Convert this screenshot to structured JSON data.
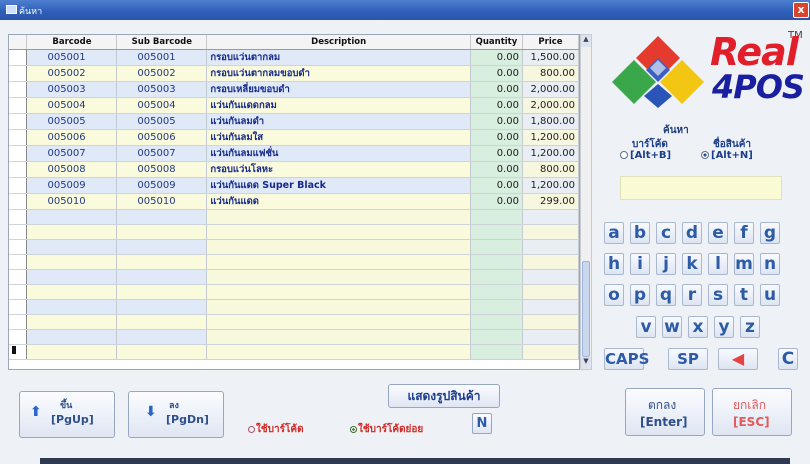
{
  "window": {
    "title": "ค้นหา",
    "close_glyph": "x"
  },
  "grid": {
    "columns": [
      "Barcode",
      "Sub Barcode",
      "Description",
      "Quantity",
      "Price"
    ],
    "rows": [
      {
        "barcode": "005001",
        "sub_barcode": "005001",
        "description": "กรอบแว่นตากลม",
        "quantity": "0.00",
        "price": "1,500.00"
      },
      {
        "barcode": "005002",
        "sub_barcode": "005002",
        "description": "กรอบแว่นตากลมขอบดำ",
        "quantity": "0.00",
        "price": "800.00"
      },
      {
        "barcode": "005003",
        "sub_barcode": "005003",
        "description": "กรอบเหลี่ยมขอบดำ",
        "quantity": "0.00",
        "price": "2,000.00"
      },
      {
        "barcode": "005004",
        "sub_barcode": "005004",
        "description": "แว่นกันแดดกลม",
        "quantity": "0.00",
        "price": "2,000.00"
      },
      {
        "barcode": "005005",
        "sub_barcode": "005005",
        "description": "แว่นกันลมดำ",
        "quantity": "0.00",
        "price": "1,800.00"
      },
      {
        "barcode": "005006",
        "sub_barcode": "005006",
        "description": "แว่นกันลมใส",
        "quantity": "0.00",
        "price": "1,200.00"
      },
      {
        "barcode": "005007",
        "sub_barcode": "005007",
        "description": "แว่นกันลมแฟชั่น",
        "quantity": "0.00",
        "price": "1,200.00"
      },
      {
        "barcode": "005008",
        "sub_barcode": "005008",
        "description": "กรอบแว่นโลหะ",
        "quantity": "0.00",
        "price": "800.00"
      },
      {
        "barcode": "005009",
        "sub_barcode": "005009",
        "description": "แว่นกันแดด Super Black",
        "quantity": "0.00",
        "price": "1,200.00"
      },
      {
        "barcode": "005010",
        "sub_barcode": "005010",
        "description": "แว่นกันแดด",
        "quantity": "0.00",
        "price": "299.00"
      }
    ],
    "empty_rows": 10
  },
  "logo": {
    "tm": "TM",
    "line1": "Real",
    "line2": "4POS"
  },
  "search": {
    "label": "ค้นหา",
    "options": [
      {
        "label": "บาร์โค้ด",
        "shortcut": "[Alt+B]",
        "selected": false
      },
      {
        "label": "ชื่อสินค้า",
        "shortcut": "[Alt+N]",
        "selected": true
      }
    ],
    "input_value": ""
  },
  "keypad": {
    "rows": [
      [
        "a",
        "b",
        "c",
        "d",
        "e",
        "f",
        "g"
      ],
      [
        "h",
        "i",
        "j",
        "k",
        "l",
        "m",
        "n"
      ],
      [
        "o",
        "p",
        "q",
        "r",
        "s",
        "t",
        "u"
      ],
      [
        "v",
        "w",
        "x",
        "y",
        "z"
      ]
    ],
    "caps": "CAPS",
    "space": "SP",
    "clear": "C"
  },
  "bottom": {
    "page_up": {
      "label": "ขึ้น",
      "shortcut": "[PgUp]"
    },
    "page_down": {
      "label": "ลง",
      "shortcut": "[PgDn]"
    },
    "show_picture": "แสดงรูปสินค้า",
    "n_button": "N",
    "barcode_mode": [
      {
        "label": "ใช้บาร์โค้ด",
        "selected": false
      },
      {
        "label": "ใช้บาร์โค้ดย่อย",
        "selected": true
      }
    ],
    "ok": {
      "label": "ตกลง",
      "shortcut": "[Enter]"
    },
    "cancel": {
      "label": "ยกเลิก",
      "shortcut": "[ESC]"
    }
  },
  "colors": {
    "accent": "#2e5ba6",
    "danger": "#e01f2b",
    "brand_blue": "#1a1fa0"
  }
}
